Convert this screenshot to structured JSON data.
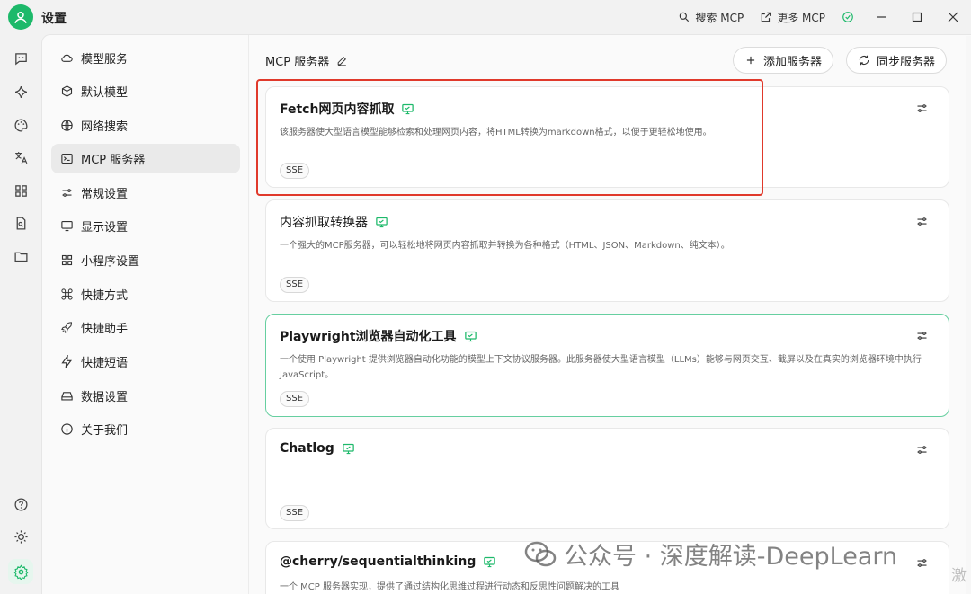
{
  "app": {
    "title": "设置"
  },
  "titlebar": {
    "search_mcp": "搜索 MCP",
    "more_mcp": "更多 MCP",
    "accent": "#1db96a"
  },
  "rail": {
    "icons": [
      "chat-icon",
      "sparkle-icon",
      "palette-icon",
      "translate-icon",
      "apps-grid-icon",
      "file-search-icon",
      "folder-icon",
      "help-icon",
      "brightness-icon",
      "settings-gear-icon"
    ]
  },
  "nav": {
    "items": [
      {
        "label": "模型服务",
        "icon": "cloud-icon"
      },
      {
        "label": "默认模型",
        "icon": "cube-icon"
      },
      {
        "label": "网络搜索",
        "icon": "globe-icon"
      },
      {
        "label": "MCP 服务器",
        "icon": "terminal-icon",
        "active": true
      },
      {
        "label": "常规设置",
        "icon": "sliders-icon"
      },
      {
        "label": "显示设置",
        "icon": "monitor-icon"
      },
      {
        "label": "小程序设置",
        "icon": "grid-icon"
      },
      {
        "label": "快捷方式",
        "icon": "command-icon"
      },
      {
        "label": "快捷助手",
        "icon": "rocket-icon"
      },
      {
        "label": "快捷短语",
        "icon": "zap-icon"
      },
      {
        "label": "数据设置",
        "icon": "hard-drive-icon"
      },
      {
        "label": "关于我们",
        "icon": "info-icon"
      }
    ]
  },
  "content": {
    "title": "MCP 服务器",
    "add_server": "添加服务器",
    "sync_servers": "同步服务器",
    "servers": [
      {
        "name": "Fetch网页内容抓取",
        "description": "该服务器使大型语言模型能够检索和处理网页内容，将HTML转换为markdown格式，以便于更轻松地使用。",
        "tag": "SSE"
      },
      {
        "name": "内容抓取转换器",
        "description": "一个强大的MCP服务器，可以轻松地将网页内容抓取并转换为各种格式（HTML、JSON、Markdown、纯文本）。",
        "tag": "SSE"
      },
      {
        "name": "Playwright浏览器自动化工具",
        "description": "一个使用 Playwright 提供浏览器自动化功能的模型上下文协议服务器。此服务器使大型语言模型（LLMs）能够与网页交互、截屏以及在真实的浏览器环境中执行 JavaScript。",
        "tag": "SSE"
      },
      {
        "name": "Chatlog",
        "description": "",
        "tag": "SSE"
      },
      {
        "name": "@cherry/sequentialthinking",
        "description": "一个 MCP 服务器实现，提供了通过结构化思维过程进行动态和反思性问题解决的工具",
        "tag": ""
      }
    ]
  },
  "watermark": {
    "text": "公众号 · 深度解读-DeepLearn",
    "corner": "激"
  }
}
